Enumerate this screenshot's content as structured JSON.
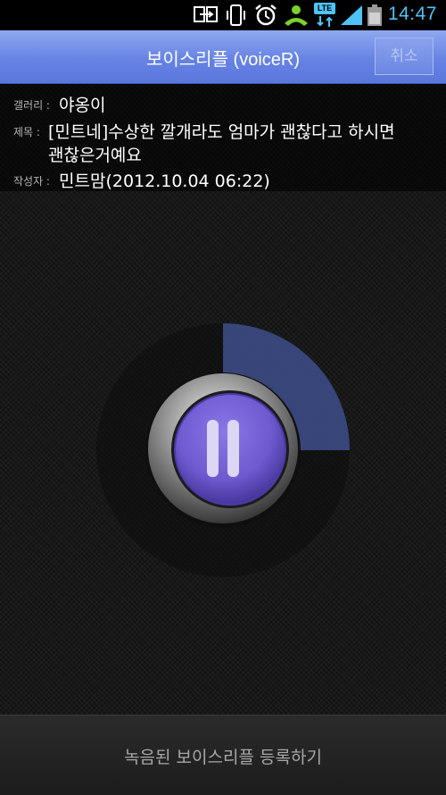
{
  "status_bar": {
    "time": "14:47",
    "icons": [
      "screen-mirror-icon",
      "vibrate-icon",
      "alarm-icon",
      "call-icon",
      "lte-data-icon",
      "signal-icon",
      "battery-icon"
    ],
    "lte_label": "LTE",
    "accent": "#4fc3f7"
  },
  "title_bar": {
    "title": "보이스리플 (voiceR)",
    "cancel_label": "취소",
    "color": "#6683e4"
  },
  "post_info": {
    "gallery_label": "갤러리 :",
    "gallery_value": "야옹이",
    "subject_label": "제목 :",
    "subject_line1": "[민트네]수상한 깔개라도 엄마가 괜찮다고 하시면",
    "subject_line2": "괜찮은거예요",
    "author_label": "작성자 :",
    "author_value": "민트맘(2012.10.04 06:22)"
  },
  "player": {
    "state_icon": "pause-icon",
    "progress_fraction": 0.25,
    "progress_color": "#3e4f8c",
    "button_color": "#6f5ad0"
  },
  "bottom_bar": {
    "register_label": "녹음된 보이스리플 등록하기"
  }
}
